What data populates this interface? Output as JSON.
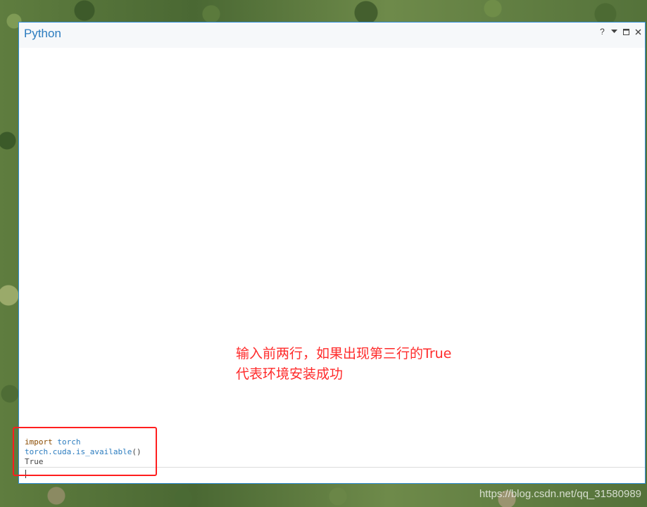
{
  "window": {
    "title": "Python",
    "controls": {
      "help": "?",
      "dropdown_icon": "chevron-down-icon",
      "maximize_icon": "maximize-icon",
      "close_icon": "close-icon"
    }
  },
  "console": {
    "lines": [
      {
        "keyword": "import",
        "name": "torch"
      },
      {
        "expr": "torch.cuda.is_available",
        "parens": "()"
      },
      {
        "result": "True"
      }
    ]
  },
  "annotation": {
    "line1": "输入前两行，如果出现第三行的True",
    "line2": "代表环境安装成功"
  },
  "watermark": "https://blog.csdn.net/qq_31580989",
  "colors": {
    "accent": "#2b7cbf",
    "highlight": "#ff1e1e",
    "keyword": "#8a4b00"
  }
}
